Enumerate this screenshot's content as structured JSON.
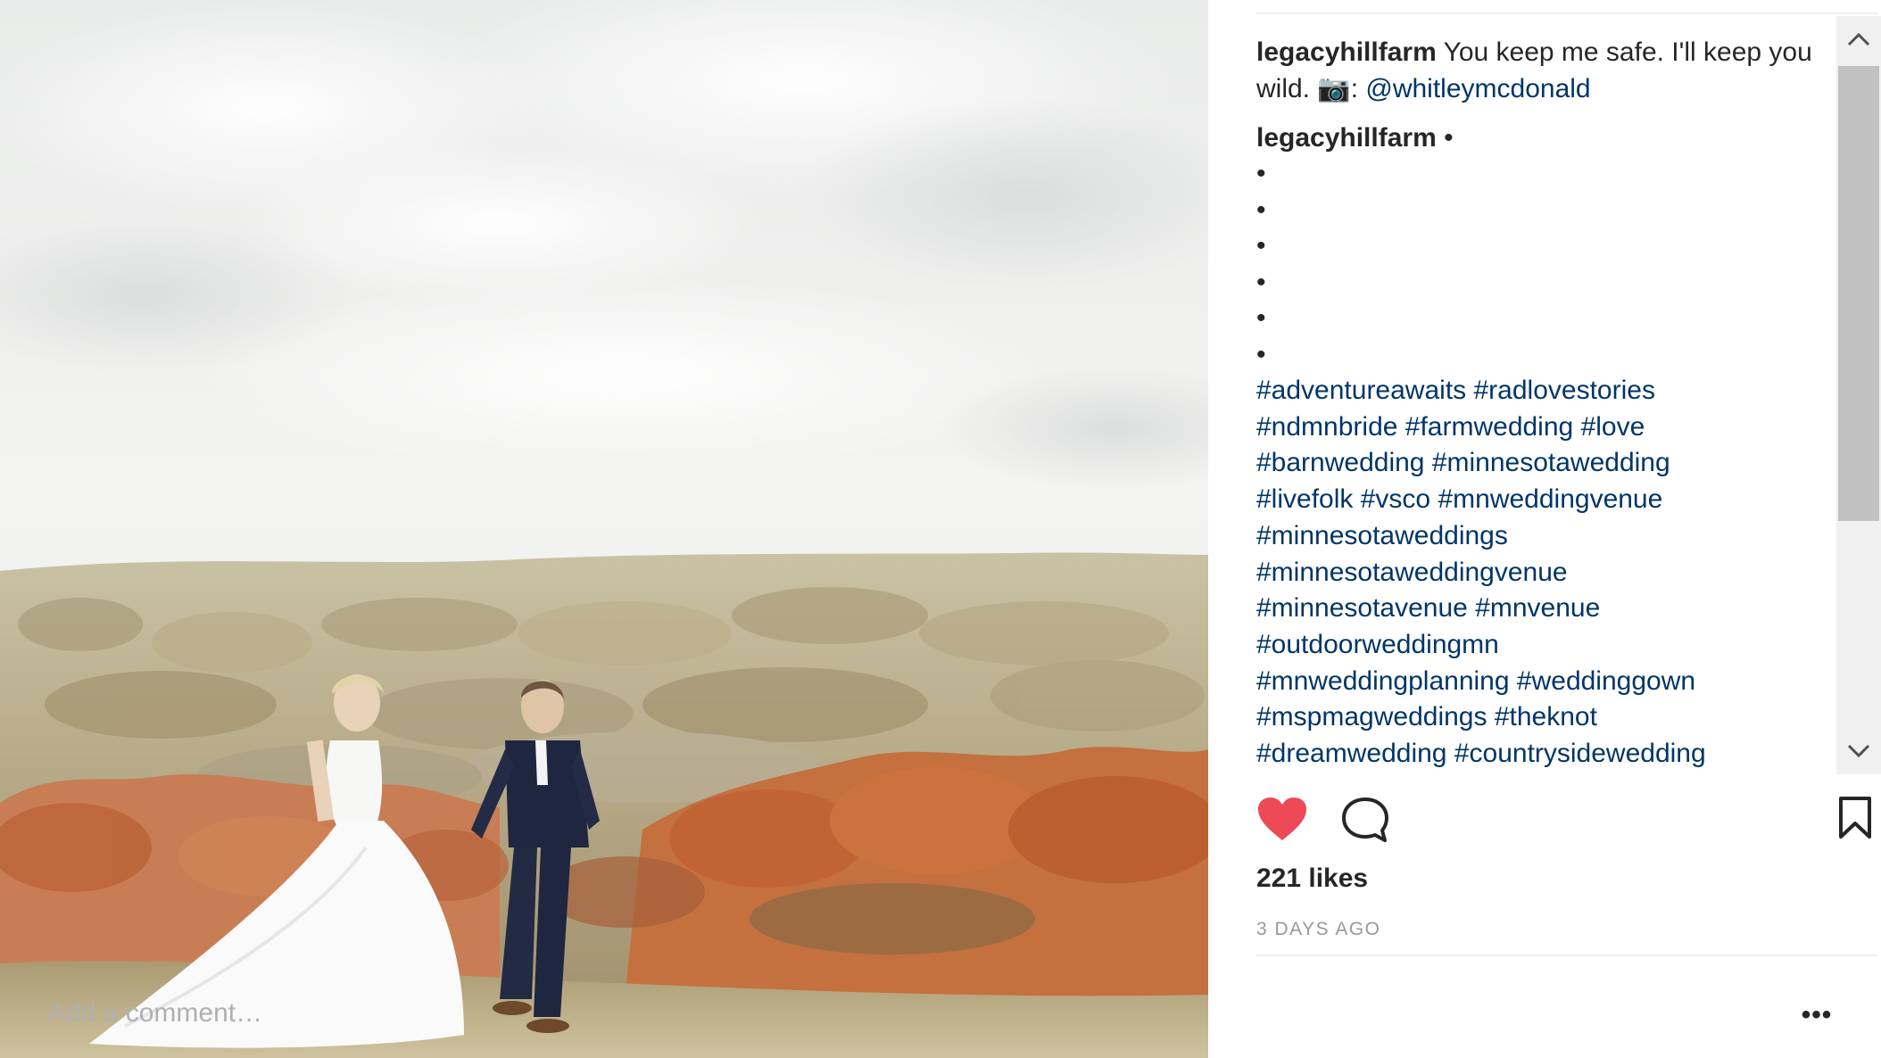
{
  "post": {
    "username": "legacyhillfarm",
    "caption_text": "You keep me safe. I'll keep you wild. 📷: ",
    "caption_mention": "@whitleymcdonald",
    "comment_username": "legacyhillfarm",
    "comment_first": "•",
    "bullets": [
      "•",
      "•",
      "•",
      "•",
      "•",
      "•"
    ],
    "hashtags": [
      [
        "#adventureawaits",
        "#radlovestories"
      ],
      [
        "#ndmnbride",
        "#farmwedding",
        "#love"
      ],
      [
        "#barnwedding",
        "#minnesotawedding"
      ],
      [
        "#livefolk",
        "#vsco",
        "#mnweddingvenue"
      ],
      [
        "#minnesotaweddings"
      ],
      [
        "#minnesotaweddingvenue"
      ],
      [
        "#minnesotavenue",
        "#mnvenue"
      ],
      [
        "#outdoorweddingmn"
      ],
      [
        "#mnweddingplanning",
        "#weddinggown"
      ],
      [
        "#mspmagweddings",
        "#theknot"
      ],
      [
        "#dreamwedding",
        "#countrysidewedding"
      ]
    ],
    "likes": "221 likes",
    "time_ago": "3 DAYS AGO"
  },
  "actions": {
    "like_icon": "heart-filled-icon",
    "comment_icon": "comment-icon",
    "save_icon": "bookmark-icon",
    "like_color": "#ed4956"
  },
  "comment_box": {
    "placeholder": "Add a comment…",
    "value": "",
    "more_label": "•••"
  },
  "colors": {
    "link": "#003569",
    "muted": "#999999",
    "text": "#262626"
  }
}
